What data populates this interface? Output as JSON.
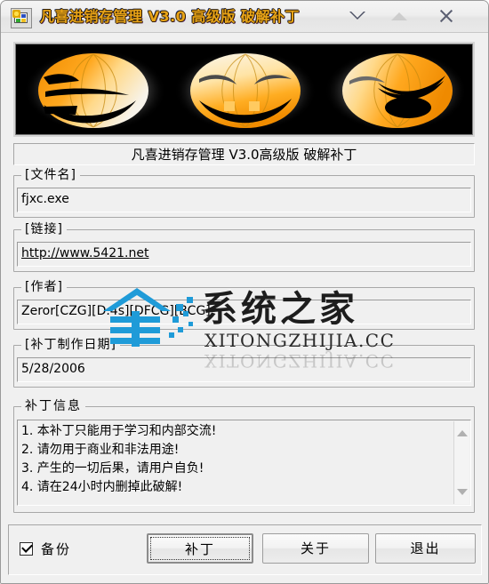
{
  "window": {
    "title": "凡喜进销存管理 V3.0 高级版 破解补丁",
    "icon": "app-window-icon",
    "controls": {
      "minimize": "minimize-icon",
      "maximize": "maximize-icon",
      "close": "close-icon"
    }
  },
  "banner": {
    "alt": "three-jack-o-lantern-pumpkins",
    "background": "#000000",
    "pumpkin_color": "#f59a0b"
  },
  "subtitle": "凡喜进销存管理 V3.0高级版 破解补丁",
  "groups": {
    "filename": {
      "label": "[文件名]",
      "value": "fjxc.exe"
    },
    "link": {
      "label": "[链接]",
      "value": "http://www.5421.net"
    },
    "author": {
      "label": "[作者]",
      "value": "Zeror[CZG][D.4s][DFCG][BCG]"
    },
    "date": {
      "label": "[补丁制作日期]",
      "value": "5/28/2006"
    },
    "info": {
      "label": "补丁信息",
      "lines": [
        "1. 本补丁只能用于学习和内部交流!",
        "2. 请勿用于商业和非法用途!",
        "3. 产生的一切后果，请用户自负!",
        "4. 请在24小时内删掉此破解!"
      ],
      "text": "1. 本补丁只能用于学习和内部交流!\n2. 请勿用于商业和非法用途!\n3. 产生的一切后果，请用户自负!\n4. 请在24小时内删掉此破解!",
      "scrollbar": {
        "up": "scroll-up-icon",
        "down": "scroll-down-icon"
      }
    }
  },
  "bottom": {
    "backup_checkbox": {
      "label": "备份",
      "checked": true
    },
    "patch_button": "补丁",
    "about_button": "关于",
    "exit_button": "退出"
  },
  "watermark": {
    "chinese": "系统之家",
    "english": "XITONGZHIJIA.CC",
    "logo_color": "#1f9bd8"
  },
  "colors": {
    "window_bg": "#f0f0f0",
    "title_text": "#e8a317",
    "banner_bg": "#000000",
    "field_text": "#000000"
  }
}
